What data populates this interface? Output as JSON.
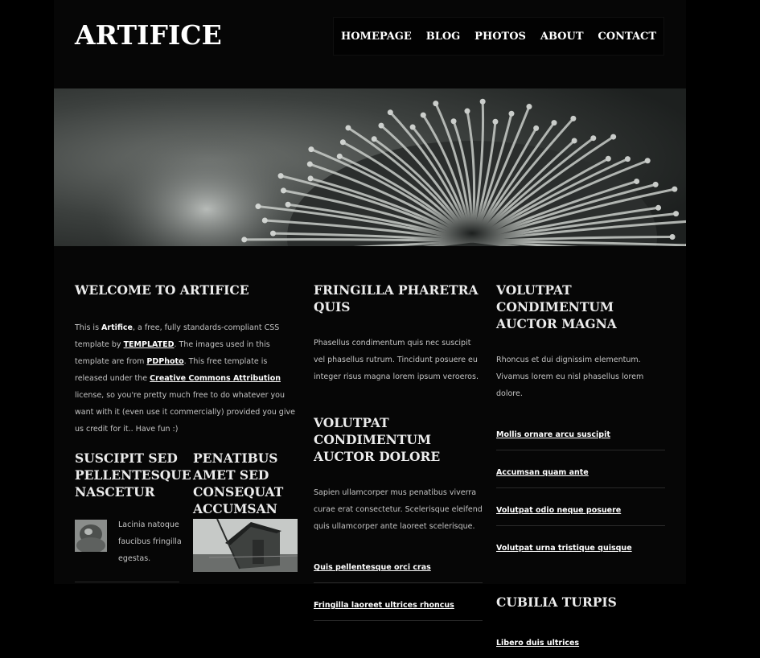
{
  "brand": "ARTIFICE",
  "nav": [
    "HOMEPAGE",
    "BLOG",
    "PHOTOS",
    "ABOUT",
    "CONTACT"
  ],
  "welcome": {
    "title": "WELCOME TO ARTIFICE",
    "t1": "This is ",
    "t2": "Artifice",
    "t3": ", a free, fully standards-compliant CSS template by ",
    "l1": "TEMPLATED",
    "t4": ". The images used in this template are from ",
    "l2": "PDPhoto",
    "t5": ". This free template is released under the ",
    "l3": "Creative Commons Attribution",
    "t6": " license, so you're pretty much free to do whatever you want with it (even use it commercially) provided you give us credit for it.. Have fun :)"
  },
  "sub1": {
    "title": "SUSCIPIT SED PELLENTESQUE NASCETUR",
    "text": "Lacinia natoque faucibus fringilla egestas."
  },
  "sub2": {
    "title": "PENATIBUS AMET SED CONSEQUAT ACCUMSAN"
  },
  "mid1": {
    "title": "FRINGILLA PHARETRA QUIS",
    "text": "Phasellus condimentum quis nec suscipit vel phasellus rutrum. Tincidunt posuere eu integer risus magna lorem ipsum veroeros."
  },
  "mid2": {
    "title": "VOLUTPAT CONDIMENTUM AUCTOR DOLORE",
    "text": "Sapien ullamcorper mus penatibus viverra curae erat consectetur. Scelerisque eleifend quis ullamcorper ante laoreet scelerisque.",
    "links": [
      "Quis pellentesque orci cras",
      "Fringilla laoreet ultrices rhoncus"
    ]
  },
  "right1": {
    "title": "VOLUTPAT CONDIMENTUM AUCTOR MAGNA",
    "text": "Rhoncus et dui dignissim elementum. Vivamus lorem eu nisl phasellus lorem dolore.",
    "links": [
      "Mollis ornare arcu suscipit",
      "Accumsan quam ante",
      "Volutpat odio neque posuere",
      "Volutpat urna tristique quisque"
    ]
  },
  "right2": {
    "title": "CUBILIA TURPIS",
    "links": [
      "Libero duis ultrices"
    ]
  },
  "images": {
    "hero": "flower-photo",
    "thumb1": "statue-photo",
    "thumb2": "barn-photo"
  }
}
